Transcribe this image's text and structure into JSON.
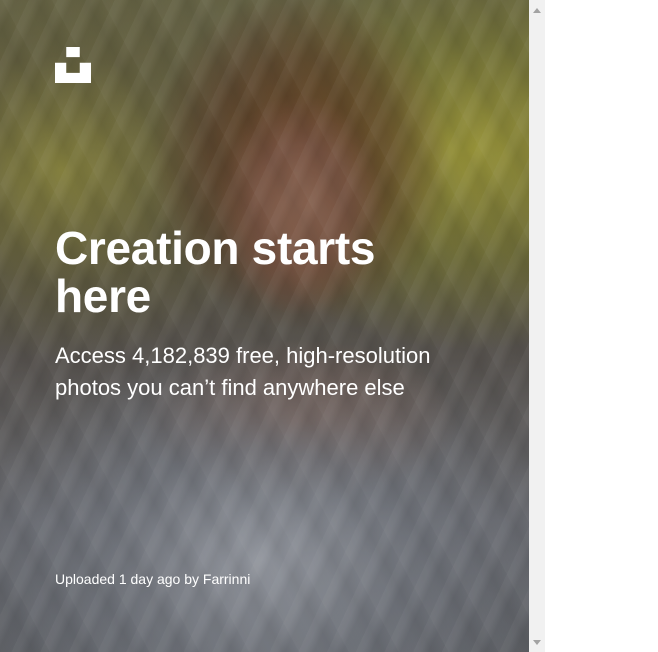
{
  "hero": {
    "headline": "Creation starts here",
    "subline": "Access 4,182,839 free, high-resolution photos you can’t find anywhere else",
    "credit_prefix": "Uploaded 1 day ago by",
    "credit_author": "Farrinni"
  },
  "icons": {
    "logo": "unsplash-logo-icon",
    "scroll_up": "chevron-up-icon",
    "scroll_down": "chevron-down-icon"
  },
  "colors": {
    "text": "#ffffff",
    "scrollbar_track": "#f1f1f1",
    "scrollbar_arrow": "#a3a3a3"
  }
}
